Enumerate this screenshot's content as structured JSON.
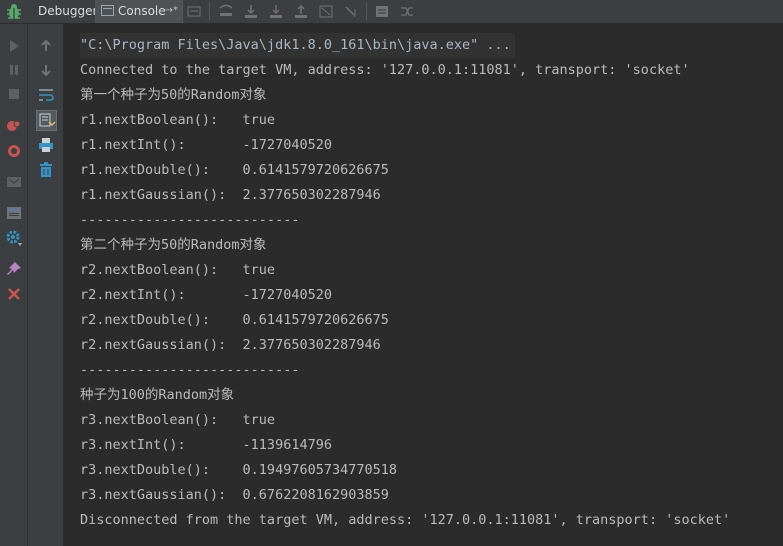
{
  "toolbar": {
    "tabs": [
      {
        "label": "Debugger"
      },
      {
        "label": "Console"
      }
    ],
    "console_pin": "→*"
  },
  "console": {
    "command": "\"C:\\Program Files\\Java\\jdk1.8.0_161\\bin\\java.exe\" ...",
    "lines": [
      "Connected to the target VM, address: '127.0.0.1:11081', transport: 'socket'",
      "第一个种子为50的Random对象",
      "r1.nextBoolean():   true",
      "r1.nextInt():       -1727040520",
      "r1.nextDouble():    0.6141579720626675",
      "r1.nextGaussian():  2.377650302287946",
      "---------------------------",
      "第二个种子为50的Random对象",
      "r2.nextBoolean():   true",
      "r2.nextInt():       -1727040520",
      "r2.nextDouble():    0.6141579720626675",
      "r2.nextGaussian():  2.377650302287946",
      "---------------------------",
      "种子为100的Random对象",
      "r3.nextBoolean():   true",
      "r3.nextInt():       -1139614796",
      "r3.nextDouble():    0.19497605734770518",
      "r3.nextGaussian():  0.6762208162903859",
      "Disconnected from the target VM, address: '127.0.0.1:11081', transport: 'socket'"
    ]
  }
}
